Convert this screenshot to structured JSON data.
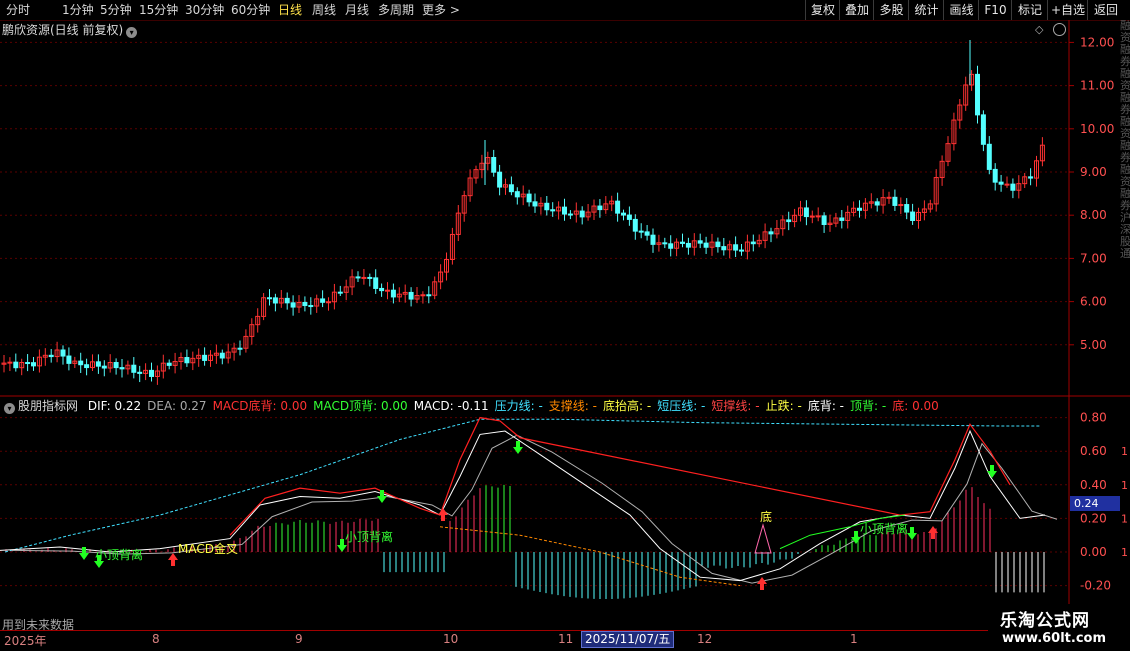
{
  "toolbar": {
    "periods": [
      "分时",
      "1分钟",
      "5分钟",
      "15分钟",
      "30分钟",
      "60分钟",
      "日线",
      "周线",
      "月线",
      "多周期",
      "更多 >"
    ],
    "active_period": "日线",
    "buttons": [
      "复权",
      "叠加",
      "多股",
      "统计",
      "画线",
      "F10",
      "标记",
      "+自选",
      "返回"
    ]
  },
  "main_chart": {
    "title": "鹏欣资源(日线 前复权)",
    "price_ticks": [
      "12.00",
      "11.00",
      "10.00",
      "9.00",
      "8.00",
      "7.00",
      "6.00",
      "5.00"
    ],
    "colors": {
      "up": "#ff3232",
      "down": "#54ffff",
      "axis": "#a00000"
    }
  },
  "indicator": {
    "name": "股朋指标网",
    "fields": [
      {
        "text": "DIF: 0.22",
        "color": "#ffffff"
      },
      {
        "text": "DEA: 0.27",
        "color": "#a8a8a8"
      },
      {
        "text": "MACD底背: 0.00",
        "color": "#ff3232"
      },
      {
        "text": "MACD顶背: 0.00",
        "color": "#33ff33"
      },
      {
        "text": "MACD: -0.11",
        "color": "#ffffff"
      },
      {
        "text": "压力线: -",
        "color": "#40e0ff"
      },
      {
        "text": "支撑线: -",
        "color": "#ff8800"
      },
      {
        "text": "底抬高: -",
        "color": "#ffff44"
      },
      {
        "text": "短压线: -",
        "color": "#40e0ff"
      },
      {
        "text": "短撑线: -",
        "color": "#ff4444"
      },
      {
        "text": "止跌: -",
        "color": "#ffff44"
      },
      {
        "text": "底背: -",
        "color": "#ffffff"
      },
      {
        "text": "顶背: -",
        "color": "#33ff33"
      },
      {
        "text": "底: 0.00",
        "color": "#ff3232"
      }
    ],
    "ticks": [
      "0.80",
      "0.60",
      "0.40",
      "0.20",
      "0.00",
      "-0.20"
    ],
    "current_value": "0.24",
    "labels": {
      "small_top_div": "小顶背离",
      "macd_cross": "MACD金叉",
      "bottom": "底"
    },
    "right_ticks_partial": [
      "1",
      "1",
      "1",
      "1"
    ]
  },
  "footer": {
    "note": "用到未来数据",
    "time_labels": [
      "2025年",
      "8",
      "9",
      "10",
      "11",
      "12",
      "1"
    ],
    "current_date": "2025/11/07/五",
    "watermark_title": "乐淘公式网",
    "watermark_url": "www.60lt.com"
  },
  "side_strip": "融资融券融资融券融资融券融资融券沪深股通"
}
